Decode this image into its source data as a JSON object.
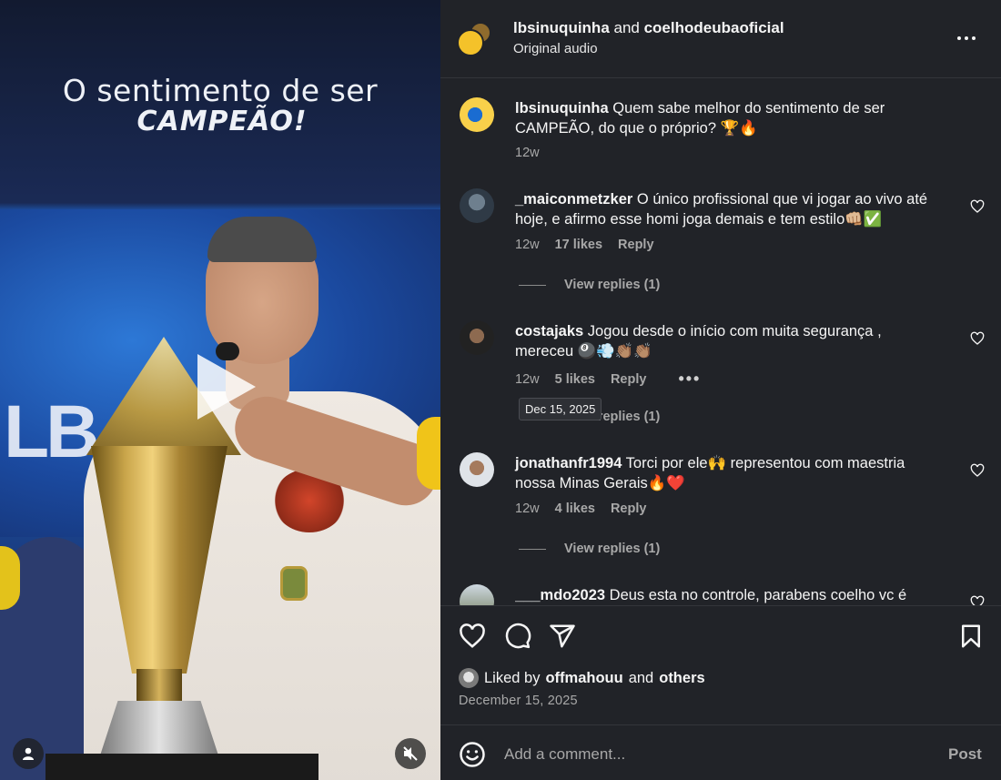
{
  "video": {
    "headline_line1": "O sentimento de ser",
    "headline_line2": "CAMPEÃO!",
    "play_icon": "play-icon",
    "user_tag_icon": "user-tag-icon",
    "mute_icon": "muted-speaker-icon"
  },
  "header": {
    "user1": "lbsinuquinha",
    "and_text": " and ",
    "user2": "coelhodeubaoficial",
    "subtitle": "Original audio",
    "more_icon": "more-options-icon"
  },
  "caption": {
    "username": "lbsinuquinha",
    "text": " Quem sabe melhor do sentimento de ser CAMPEÃO, do que o próprio? 🏆🔥",
    "time": "12w"
  },
  "comments": [
    {
      "username": "_maiconmetzker",
      "text": " O único profissional que vi jogar ao vivo até hoje, e afirmo esse homi joga demais e tem estilo👊🏼✅",
      "time": "12w",
      "likes": "17 likes",
      "reply_label": "Reply",
      "view_replies": "View replies (1)"
    },
    {
      "username": "costajaks",
      "text": " Jogou desde o início com muita segurança , mereceu 🎱💨👏🏽👏🏽",
      "time": "12w",
      "likes": "5 likes",
      "reply_label": "Reply",
      "more_dots": "•••",
      "view_replies": "View replies (1)"
    },
    {
      "username": "jonathanfr1994",
      "text": " Torci por ele🙌 representou com maestria nossa Minas Gerais🔥❤️",
      "time": "12w",
      "likes": "4 likes",
      "reply_label": "Reply",
      "view_replies": "View replies (1)"
    },
    {
      "username": "___mdo2023",
      "text": " Deus esta no controle, parabens coelho vc é"
    }
  ],
  "tooltip": "Dec 15, 2025",
  "actions": {
    "like_icon": "heart-icon",
    "comment_icon": "comment-icon",
    "share_icon": "share-icon",
    "save_icon": "bookmark-icon"
  },
  "likes": {
    "prefix": "Liked by ",
    "user": "offmahouu",
    "and_text": " and ",
    "others": "others"
  },
  "post_date": "December 15, 2025",
  "add_comment": {
    "emoji_icon": "emoji-icon",
    "placeholder": "Add a comment...",
    "post_label": "Post"
  },
  "colors": {
    "panel_bg": "#212328",
    "text_primary": "#f5f5f5",
    "text_secondary": "#a8a8a8"
  }
}
